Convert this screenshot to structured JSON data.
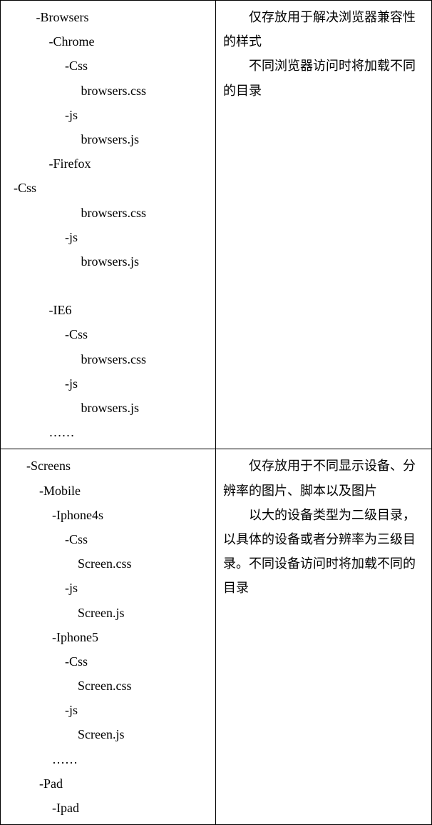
{
  "rows": [
    {
      "left_text": "       -Browsers\n           -Chrome\n                -Css\n                     browsers.css\n                -js\n                     browsers.js\n           -Firefox\n-Css\n                     browsers.css\n                -js\n                     browsers.js\n\n           -IE6\n                -Css\n                     browsers.css\n                -js\n                     browsers.js\n           ……",
      "right_p1": "仅存放用于解决浏览器兼容性的样式",
      "right_p2": "不同浏览器访问时将加载不同的目录"
    },
    {
      "left_text": "    -Screens\n        -Mobile\n            -Iphone4s\n                -Css\n                    Screen.css\n                -js\n                    Screen.js\n            -Iphone5\n                -Css\n                    Screen.css\n                -js\n                    Screen.js\n            ……\n        -Pad\n            -Ipad",
      "right_p1": "仅存放用于不同显示设备、分辨率的图片、脚本以及图片",
      "right_p2": "以大的设备类型为二级目录，以具体的设备或者分辨率为三级目录。不同设备访问时将加载不同的目录"
    }
  ]
}
